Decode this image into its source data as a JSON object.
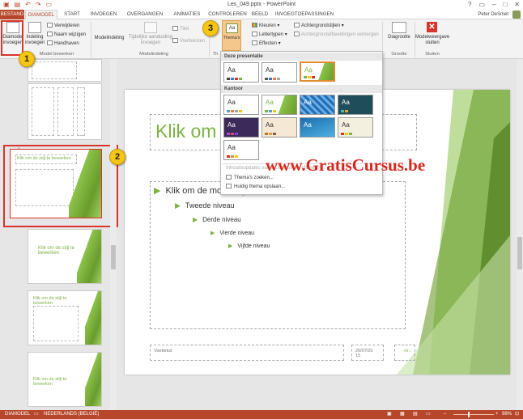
{
  "window": {
    "title": "Les_049.pptx - PowerPoint",
    "controls": [
      "?",
      "▭",
      "–",
      "□",
      "✕"
    ],
    "user": "Peter DeSmet"
  },
  "qat_icons": [
    "save-icon",
    "undo-icon",
    "redo-icon",
    "start-presentation-icon"
  ],
  "tabs": [
    {
      "label": "BESTAND"
    },
    {
      "label": "DIAMODEL"
    },
    {
      "label": "START"
    },
    {
      "label": "INVOEGEN"
    },
    {
      "label": "OVERGANGEN"
    },
    {
      "label": "ANIMATIES"
    },
    {
      "label": "CONTROLEREN"
    },
    {
      "label": "BEELD"
    },
    {
      "label": "INVOEGTOEPASSINGEN"
    }
  ],
  "ribbon": {
    "insert_master": "Diamodel invoegen",
    "insert_layout": "Indeling invoegen",
    "delete": "Verwijderen",
    "rename": "Naam wijzigen",
    "preserve": "Handhaven",
    "group_edit": "Model bewerken",
    "master_layout": "Modelindeling",
    "insert_placeholder": "Tijdelijke aanduiding invoegen",
    "title_check": "Titel",
    "footers_check": "Voetteksten",
    "group_layout": "Modelindeling",
    "themes": "Thema's",
    "group_theme": "Th",
    "colors": "Kleuren",
    "fonts": "Lettertypen",
    "effects": "Effecten",
    "bg_styles": "Achtergrondstijlen",
    "hide_bg": "Achtergrondafbeeldingen verbergen",
    "slide_size": "Diagrootte",
    "group_size": "Grootte",
    "close_master": "Modelweergave sluiten",
    "group_close": "Sluiten"
  },
  "dropdown": {
    "section_presentation": "Deze presentatie",
    "section_office": "Kantoor",
    "swatch_label": "Aa",
    "menu_enable": "Inhoudsupdates van Office.com inschakelen...",
    "menu_search": "Thema's zoeken...",
    "menu_save": "Huidig thema opslaan..."
  },
  "thumbnails": {
    "numbers": [
      "1"
    ],
    "title_text": "Klik om de stijl te bewerken",
    "second_title": "Klik om de stijl te bewerken",
    "third_title": "Klik om de stijl te bewerken",
    "fourth_title": "Klik om de stijl te bewerken"
  },
  "slide": {
    "title": "Klik om de stijl te bewerken",
    "level1": "Klik om de modelstijlen te bewerken",
    "level2": "Tweede niveau",
    "level3": "Derde niveau",
    "level4": "Vierde niveau",
    "level5": "Vijfde niveau",
    "footer": "Voettekst",
    "date": "26/07/20\n15",
    "number": "‹nr.›"
  },
  "callouts": [
    "1",
    "2",
    "3"
  ],
  "watermark": "www.GratisCursus.be",
  "status": {
    "view": "DIAMODEL",
    "language": "NEDERLANDS (BELGIË)",
    "zoom": "98%"
  },
  "colors": {
    "accent": "#b7472a",
    "green": "#7cb342",
    "callout": "#f7c613",
    "highlight": "#d9342b"
  }
}
